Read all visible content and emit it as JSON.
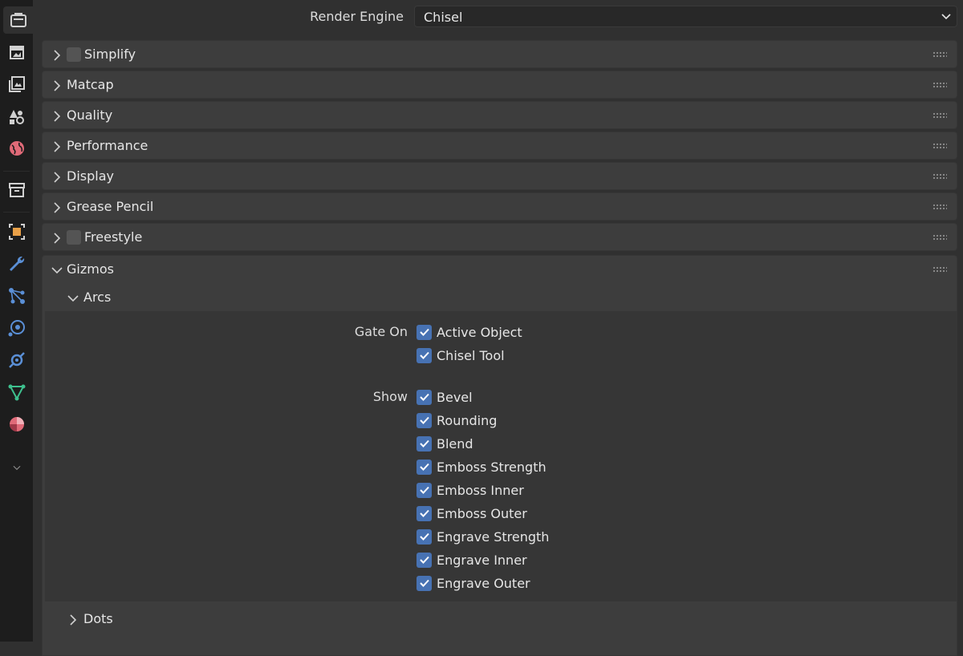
{
  "sidebar": {
    "tabs": [
      {
        "name": "render-tab-icon",
        "color": "#d0d0d0"
      },
      {
        "name": "output-tab-icon",
        "color": "#d0d0d0"
      },
      {
        "name": "view-layer-tab-icon",
        "color": "#d0d0d0"
      },
      {
        "name": "scene-tab-icon",
        "color": "#d0d0d0"
      },
      {
        "name": "world-tab-icon",
        "color": "#e06a78"
      },
      {
        "name": "collection-tab-icon",
        "color": "#d0d0d0"
      },
      {
        "name": "object-tab-icon",
        "color": "#e9a048"
      },
      {
        "name": "modifier-tab-icon",
        "color": "#5a8fd6"
      },
      {
        "name": "particles-tab-icon",
        "color": "#5a8fd6"
      },
      {
        "name": "physics-tab-icon",
        "color": "#5a8fd6"
      },
      {
        "name": "constraints-tab-icon",
        "color": "#5a8fd6"
      },
      {
        "name": "data-tab-icon",
        "color": "#3ec08e"
      },
      {
        "name": "material-tab-icon",
        "color": "#e06a78"
      },
      {
        "name": "expand-tabs-icon",
        "color": "#8a8a8a"
      }
    ]
  },
  "render_engine": {
    "label": "Render Engine",
    "value": "Chisel"
  },
  "panels": {
    "simplify": "Simplify",
    "matcap": "Matcap",
    "quality": "Quality",
    "performance": "Performance",
    "display": "Display",
    "grease_pencil": "Grease Pencil",
    "freestyle": "Freestyle",
    "gizmos": "Gizmos"
  },
  "gizmos": {
    "arcs": {
      "title": "Arcs",
      "gate_on_label": "Gate On",
      "gate_on": [
        "Active Object",
        "Chisel Tool"
      ],
      "show_label": "Show",
      "show": [
        "Bevel",
        "Rounding",
        "Blend",
        "Emboss Strength",
        "Emboss Inner",
        "Emboss Outer",
        "Engrave Strength",
        "Engrave Inner",
        "Engrave Outer"
      ]
    },
    "dots": {
      "title": "Dots"
    }
  },
  "colors": {
    "accent": "#4772b3",
    "panel": "#3d3d3d",
    "background": "#303030"
  }
}
